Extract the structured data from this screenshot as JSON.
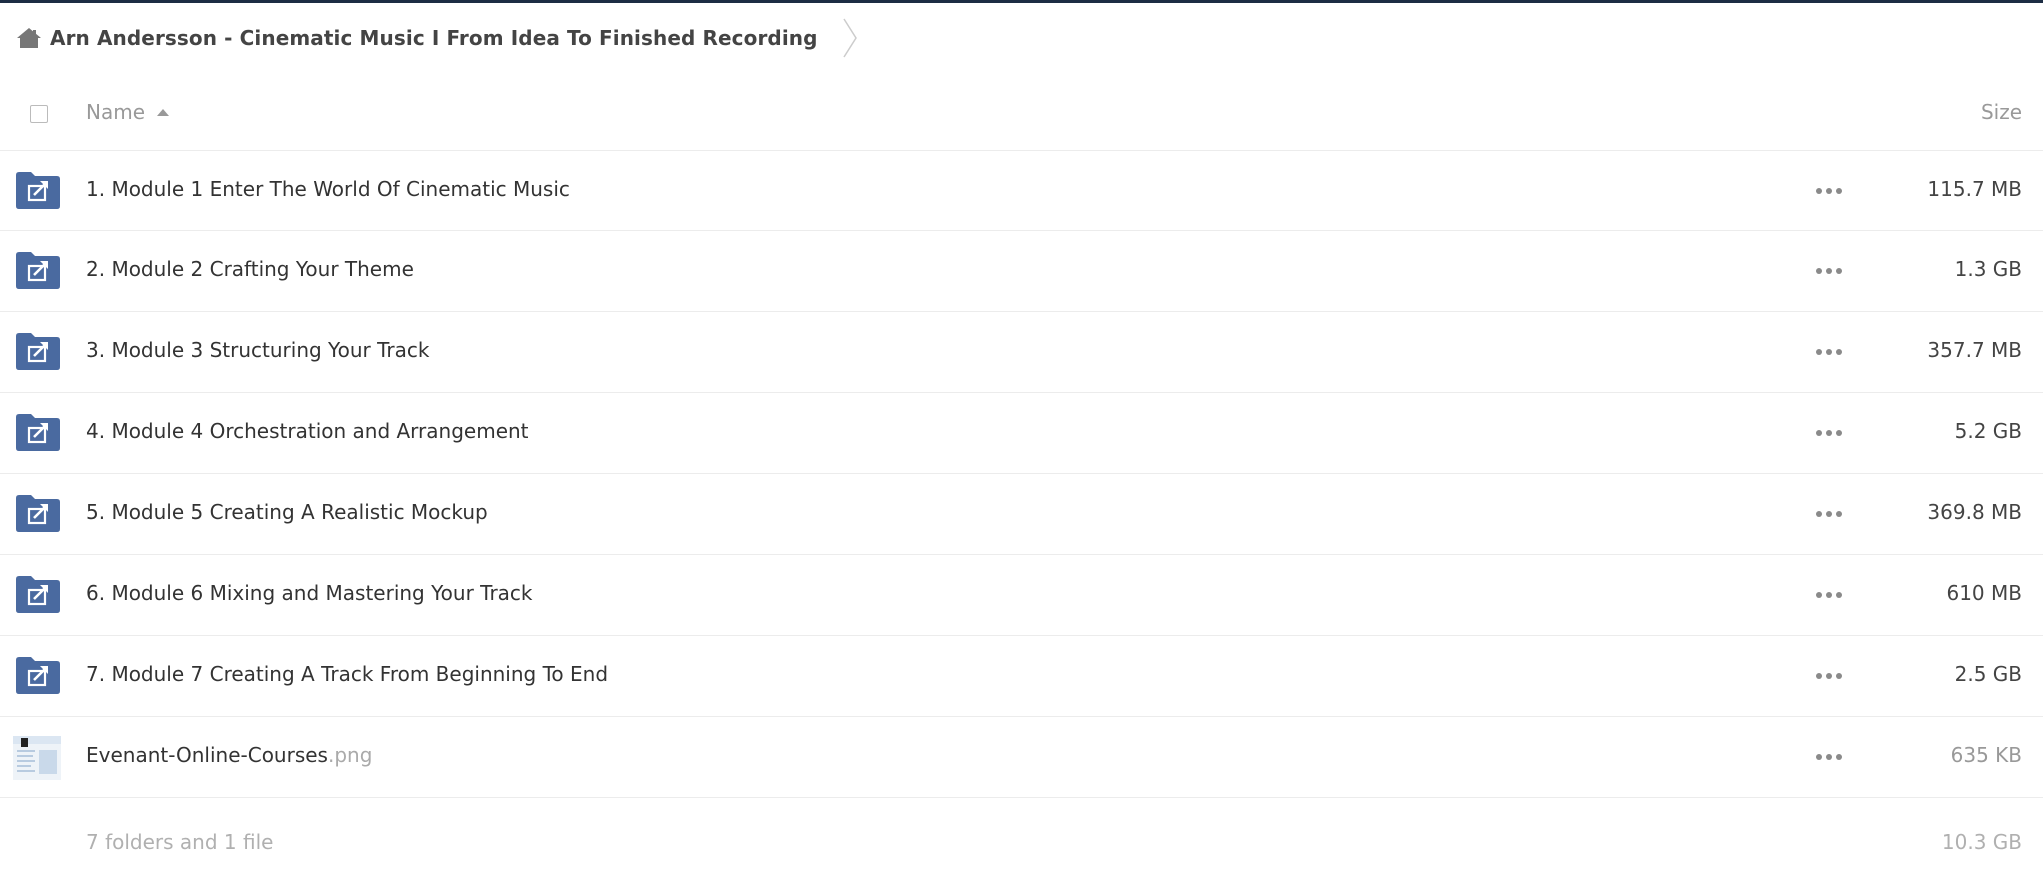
{
  "breadcrumb": {
    "icon": "home-icon",
    "label": "Arn Andersson - Cinematic Music I From Idea To Finished Recording"
  },
  "header": {
    "name_label": "Name",
    "size_label": "Size",
    "sort": "ascending"
  },
  "colors": {
    "folder": "#4a6aa0",
    "topline": "#1d2d44"
  },
  "rows": [
    {
      "type": "shared-folder",
      "icon": "shared-folder-icon",
      "name": "1. Module 1 Enter The World Of Cinematic Music",
      "ext": "",
      "size": "115.7 MB"
    },
    {
      "type": "shared-folder",
      "icon": "shared-folder-icon",
      "name": "2. Module 2 Crafting Your Theme",
      "ext": "",
      "size": "1.3 GB"
    },
    {
      "type": "shared-folder",
      "icon": "shared-folder-icon",
      "name": "3. Module 3 Structuring Your Track",
      "ext": "",
      "size": "357.7 MB"
    },
    {
      "type": "shared-folder",
      "icon": "shared-folder-icon",
      "name": "4. Module 4 Orchestration and Arrangement",
      "ext": "",
      "size": "5.2 GB"
    },
    {
      "type": "shared-folder",
      "icon": "shared-folder-icon",
      "name": "5. Module 5 Creating A Realistic Mockup",
      "ext": "",
      "size": "369.8 MB"
    },
    {
      "type": "shared-folder",
      "icon": "shared-folder-icon",
      "name": "6. Module 6 Mixing and Mastering Your Track",
      "ext": "",
      "size": "610 MB"
    },
    {
      "type": "shared-folder",
      "icon": "shared-folder-icon",
      "name": "7. Module 7 Creating A Track From Beginning To End",
      "ext": "",
      "size": "2.5 GB"
    },
    {
      "type": "file",
      "icon": "image-thumbnail",
      "name": "Evenant-Online-Courses",
      "ext": ".png",
      "size": "635 KB"
    }
  ],
  "summary": {
    "text": "7 folders and 1 file",
    "size": "10.3 GB"
  }
}
